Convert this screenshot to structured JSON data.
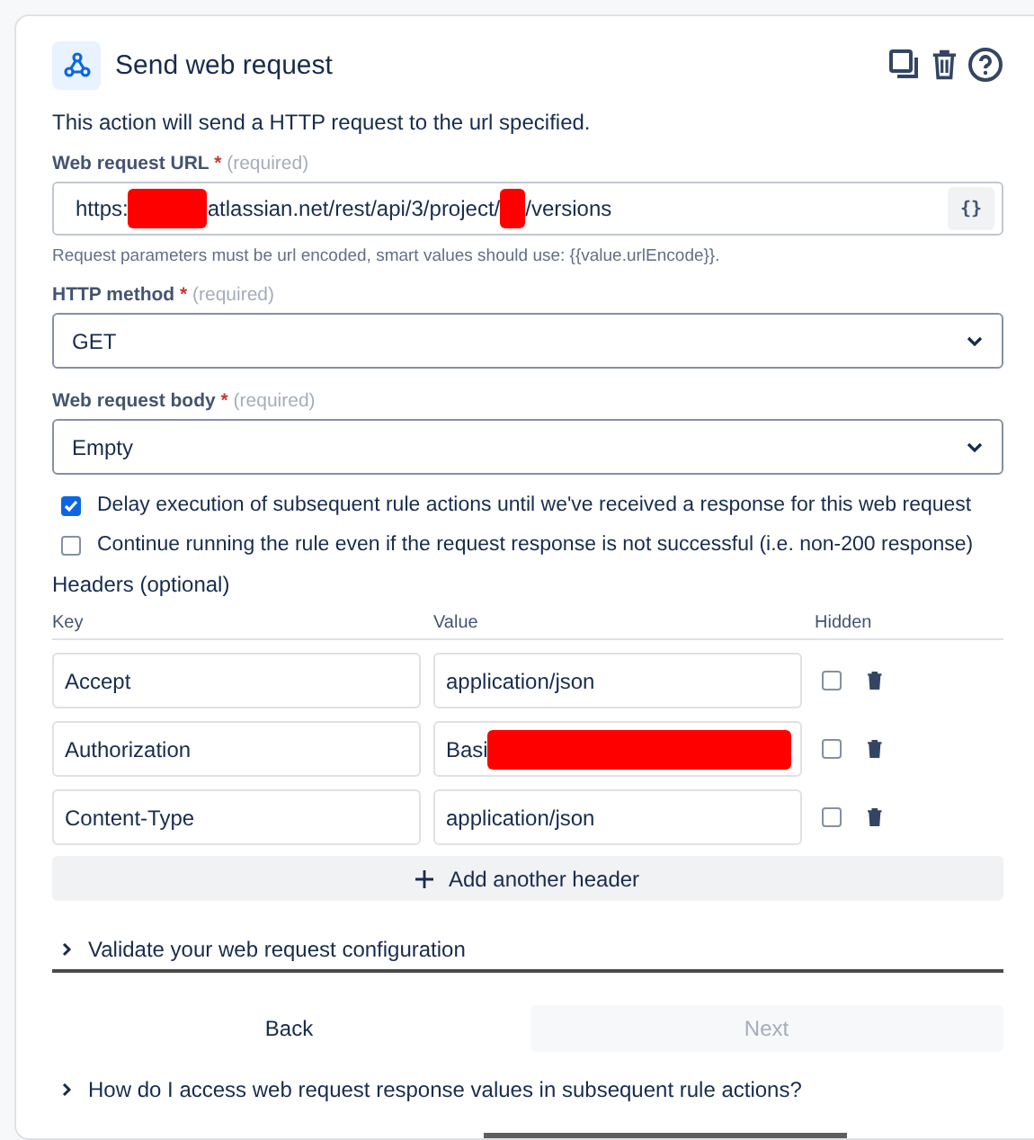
{
  "title": "Send web request",
  "description": "This action will send a HTTP request to the url specified.",
  "url_field": {
    "label": "Web request URL",
    "required_mark": "*",
    "required_hint": "(required)",
    "parts": [
      {
        "kind": "text",
        "text": "https:"
      },
      {
        "kind": "redacted"
      },
      {
        "kind": "text",
        "text": "atlassian.net/rest/api/3/project/"
      },
      {
        "kind": "redacted"
      },
      {
        "kind": "text",
        "text": "/versions"
      }
    ],
    "smart_button": "{}",
    "helper": "Request parameters must be url encoded, smart values should use: {{value.urlEncode}}."
  },
  "selects": [
    {
      "label": "HTTP method",
      "required_mark": "*",
      "required_hint": "(required)",
      "value": "GET"
    },
    {
      "label": "Web request body",
      "required_mark": "*",
      "required_hint": "(required)",
      "value": "Empty"
    }
  ],
  "options": [
    {
      "label": "Delay execution of subsequent rule actions until we've received a response for this web request",
      "checked": true
    },
    {
      "label": "Continue running the rule even if the request response is not successful (i.e. non-200 response)",
      "checked": false
    }
  ],
  "headers": {
    "title": "Headers (optional)",
    "columns": [
      "Key",
      "Value",
      "Hidden"
    ],
    "rows": [
      {
        "key": "Accept",
        "value": "application/json",
        "redacted": false,
        "hidden": false
      },
      {
        "key": "Authorization",
        "value": "Basi",
        "redacted": true,
        "hidden": false
      },
      {
        "key": "Content-Type",
        "value": "application/json",
        "redacted": false,
        "hidden": false
      }
    ],
    "add_button": "Add another header"
  },
  "validate": {
    "label": "Validate your web request configuration",
    "expanded": false
  },
  "buttons": [
    {
      "label": "Back",
      "disabled": false
    },
    {
      "label": "Next",
      "disabled": true
    }
  ],
  "faq": {
    "label": "How do I access web request response values in subsequent rule actions?",
    "expanded": false
  }
}
